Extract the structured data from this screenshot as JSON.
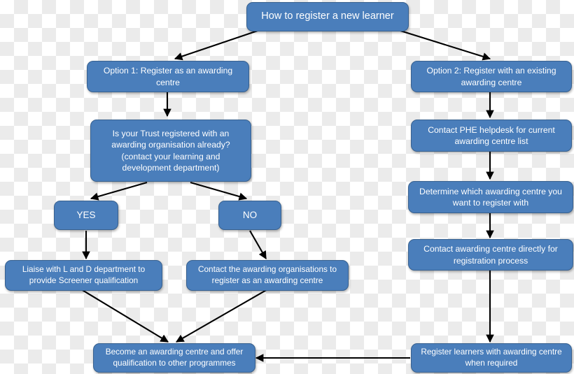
{
  "diagram": {
    "title": "How to register a new learner",
    "accent_color": "#4a7ebb",
    "border_color": "#38618f",
    "text_color": "#ffffff",
    "edge_color": "#000000"
  },
  "nodes": {
    "root": "How to register a new learner",
    "option1": "Option 1: Register as an awarding centre",
    "option2": "Option 2: Register with an existing awarding centre",
    "trust_question": "Is your Trust  registered with an awarding organisation already? (contact your learning and development department)",
    "phe_helpdesk": "Contact PHE helpdesk for current awarding centre list",
    "determine_centre": "Determine which awarding centre you want to register with",
    "contact_centre": "Contact awarding centre directly for registration process",
    "yes": "YES",
    "no": "NO",
    "liaise_ld": "Liaise with L and D department to provide Screener qualification",
    "contact_orgs": "Contact the awarding organisations to register as an awarding centre",
    "become_centre": "Become an awarding centre and offer qualification to other programmes",
    "register_learners": "Register learners with awarding centre when required"
  },
  "edges": [
    {
      "name": "root-to-option1",
      "from": "root",
      "to": "option1"
    },
    {
      "name": "root-to-option2",
      "from": "root",
      "to": "option2"
    },
    {
      "name": "option1-to-trust-question",
      "from": "option1",
      "to": "trust_question"
    },
    {
      "name": "trust-question-to-yes",
      "from": "trust_question",
      "to": "yes"
    },
    {
      "name": "trust-question-to-no",
      "from": "trust_question",
      "to": "no"
    },
    {
      "name": "yes-to-liaise",
      "from": "yes",
      "to": "liaise_ld"
    },
    {
      "name": "no-to-contact-orgs",
      "from": "no",
      "to": "contact_orgs"
    },
    {
      "name": "liaise-to-become-centre",
      "from": "liaise_ld",
      "to": "become_centre"
    },
    {
      "name": "contact-orgs-to-become-centre",
      "from": "contact_orgs",
      "to": "become_centre"
    },
    {
      "name": "option2-to-phe-helpdesk",
      "from": "option2",
      "to": "phe_helpdesk"
    },
    {
      "name": "phe-helpdesk-to-determine-centre",
      "from": "phe_helpdesk",
      "to": "determine_centre"
    },
    {
      "name": "determine-centre-to-contact-centre",
      "from": "determine_centre",
      "to": "contact_centre"
    },
    {
      "name": "contact-centre-to-register-learners",
      "from": "contact_centre",
      "to": "register_learners"
    },
    {
      "name": "register-learners-to-become-centre",
      "from": "register_learners",
      "to": "become_centre"
    }
  ]
}
